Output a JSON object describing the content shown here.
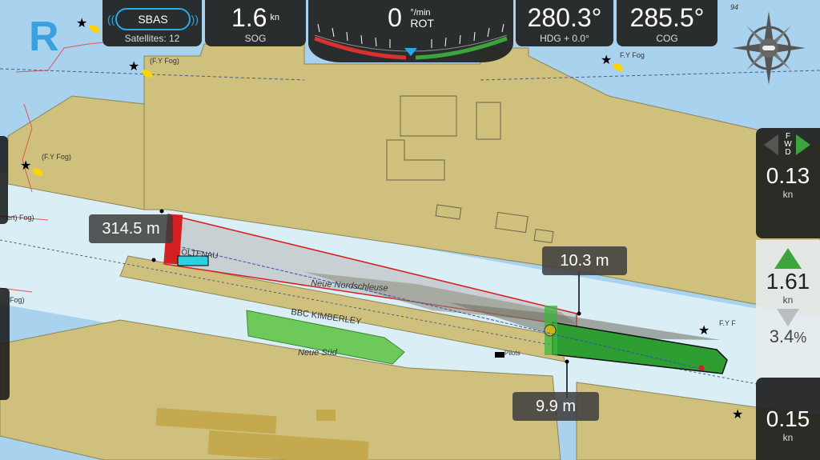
{
  "app": {
    "mode_letter": "R"
  },
  "gps": {
    "badge": "SBAS",
    "satellites_label": "Satellites: 12"
  },
  "sog": {
    "value": "1.6",
    "unit": "kn",
    "label": "SOG"
  },
  "rot": {
    "value": "0",
    "unit": "°/min",
    "label": "ROT"
  },
  "hdg": {
    "value": "280.3°",
    "label": "HDG + 0.0°"
  },
  "cog": {
    "value": "285.5°",
    "label": "COG"
  },
  "right_panel": {
    "direction_label": "FWD",
    "fwd_speed": {
      "value": "0.13",
      "unit": "kn"
    },
    "speed": {
      "value": "1.61",
      "unit": "kn"
    },
    "percent": "3.4",
    "aft_speed": {
      "value": "0.15",
      "unit": "kn"
    }
  },
  "measurements": {
    "length": "314.5 m",
    "bow_clearance": "10.3 m",
    "stern_clearance": "9.9 m"
  },
  "chart_labels": {
    "fog1": "(F.Y Fog)",
    "fog2": "(F.Y Fog)",
    "fog3": "F.Y Fog",
    "fog4": "(F.Y Fog)",
    "fog5": "ert) Fog)",
    "fog6": "Fog)",
    "fog7": "F.Y F",
    "lock_name": "Neue Nordschleuse",
    "lock_south": "Neue Süd",
    "vessel1": "BBC KIMBERLEY",
    "vessel2": "OLTENAU",
    "pilots": "Pilots",
    "depth": "94"
  },
  "colors": {
    "land": "#cfc17d",
    "water_deep": "#a9d2ef",
    "water_shallow": "#d9eef5",
    "own_ship": "#2e9e33",
    "other_vessel": "#6cc95a",
    "lock_red": "#d42020"
  }
}
